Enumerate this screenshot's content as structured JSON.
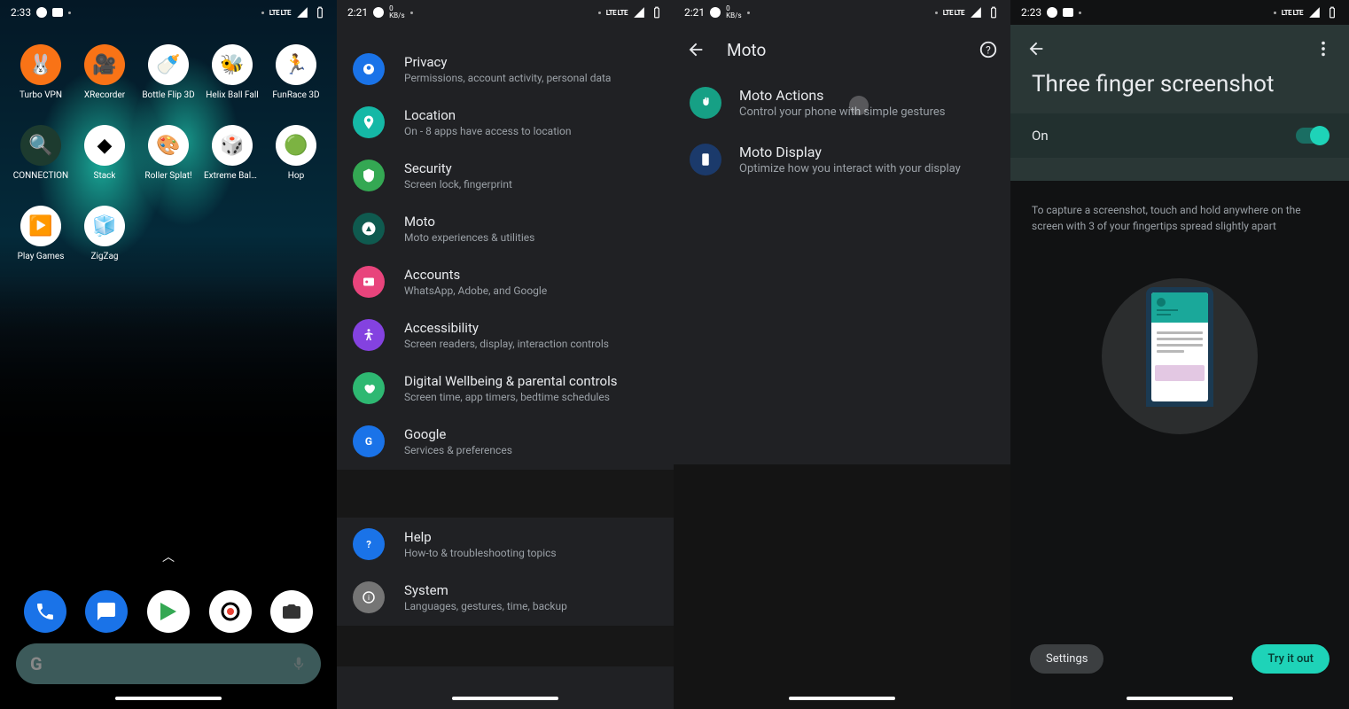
{
  "screens": {
    "home": {
      "status_time": "2:33",
      "apps": [
        {
          "label": "Turbo VPN",
          "bg": "#f97316",
          "glyph": "🐰"
        },
        {
          "label": "XRecorder",
          "bg": "#f97316",
          "glyph": "🎥"
        },
        {
          "label": "Bottle Flip 3D",
          "bg": "#ffffff",
          "glyph": "🍼"
        },
        {
          "label": "Helix Ball Fall",
          "bg": "#ffffff",
          "glyph": "🐝"
        },
        {
          "label": "FunRace 3D",
          "bg": "#ffffff",
          "glyph": "🏃"
        },
        {
          "label": "CONNECTION",
          "bg": "#1d3b2f",
          "glyph": "🔍"
        },
        {
          "label": "Stack",
          "bg": "#ffffff",
          "glyph": "◆"
        },
        {
          "label": "Roller Splat!",
          "bg": "#ffffff",
          "glyph": "🎨"
        },
        {
          "label": "Extreme Bala…",
          "bg": "#ffffff",
          "glyph": "🎲"
        },
        {
          "label": "Hop",
          "bg": "#ffffff",
          "glyph": "🟢"
        },
        {
          "label": "Play Games",
          "bg": "#ffffff",
          "glyph": "▶️"
        },
        {
          "label": "ZigZag",
          "bg": "#ffffff",
          "glyph": "🧊"
        }
      ],
      "dock": [
        {
          "name": "phone",
          "bg": "#1a73e8",
          "fill": "#fff"
        },
        {
          "name": "messages",
          "bg": "#1a73e8",
          "fill": "#fff"
        },
        {
          "name": "play-store",
          "bg": "#ffffff",
          "fill": "#34a853"
        },
        {
          "name": "chrome",
          "bg": "#ffffff",
          "fill": "#ea4335"
        },
        {
          "name": "camera",
          "bg": "#ffffff",
          "fill": "#333"
        }
      ]
    },
    "settings": {
      "status_time": "2:21",
      "status_net": "0",
      "status_net_unit": "KB/s",
      "groups": [
        [
          {
            "title": "Privacy",
            "sub": "Permissions, account activity, personal data",
            "color": "#1a73e8",
            "icon": "privacy"
          },
          {
            "title": "Location",
            "sub": "On - 8 apps have access to location",
            "color": "#15b8a6",
            "icon": "location"
          },
          {
            "title": "Security",
            "sub": "Screen lock, fingerprint",
            "color": "#34a853",
            "icon": "security"
          },
          {
            "title": "Moto",
            "sub": "Moto experiences & utilities",
            "color": "#0f5a4f",
            "icon": "moto"
          },
          {
            "title": "Accounts",
            "sub": "WhatsApp, Adobe, and Google",
            "color": "#e8447c",
            "icon": "accounts"
          },
          {
            "title": "Accessibility",
            "sub": "Screen readers, display, interaction controls",
            "color": "#8442e0",
            "icon": "accessibility"
          },
          {
            "title": "Digital Wellbeing & parental controls",
            "sub": "Screen time, app timers, bedtime schedules",
            "color": "#2eb872",
            "icon": "wellbeing"
          },
          {
            "title": "Google",
            "sub": "Services & preferences",
            "color": "#1a73e8",
            "icon": "google"
          }
        ],
        [
          {
            "title": "Help",
            "sub": "How-to & troubleshooting topics",
            "color": "#1a73e8",
            "icon": "help"
          },
          {
            "title": "System",
            "sub": "Languages, gestures, time, backup",
            "color": "#757575",
            "icon": "system"
          }
        ]
      ]
    },
    "moto": {
      "status_time": "2:21",
      "status_net": "0",
      "status_net_unit": "KB/s",
      "title": "Moto",
      "items": [
        {
          "title": "Moto Actions",
          "sub": "Control your phone with simple gestures",
          "color": "#16a085",
          "icon": "hand"
        },
        {
          "title": "Moto Display",
          "sub": "Optimize how you interact with your display",
          "color": "#1b3a6b",
          "icon": "display"
        }
      ]
    },
    "tfs": {
      "status_time": "2:23",
      "title": "Three finger screenshot",
      "on_label": "On",
      "instruction": "To capture a screenshot, touch and hold anywhere on the screen with 3 of your fingertips spread slightly apart",
      "btn_settings": "Settings",
      "btn_try": "Try it out"
    }
  },
  "status_lte": "LTE LTE"
}
